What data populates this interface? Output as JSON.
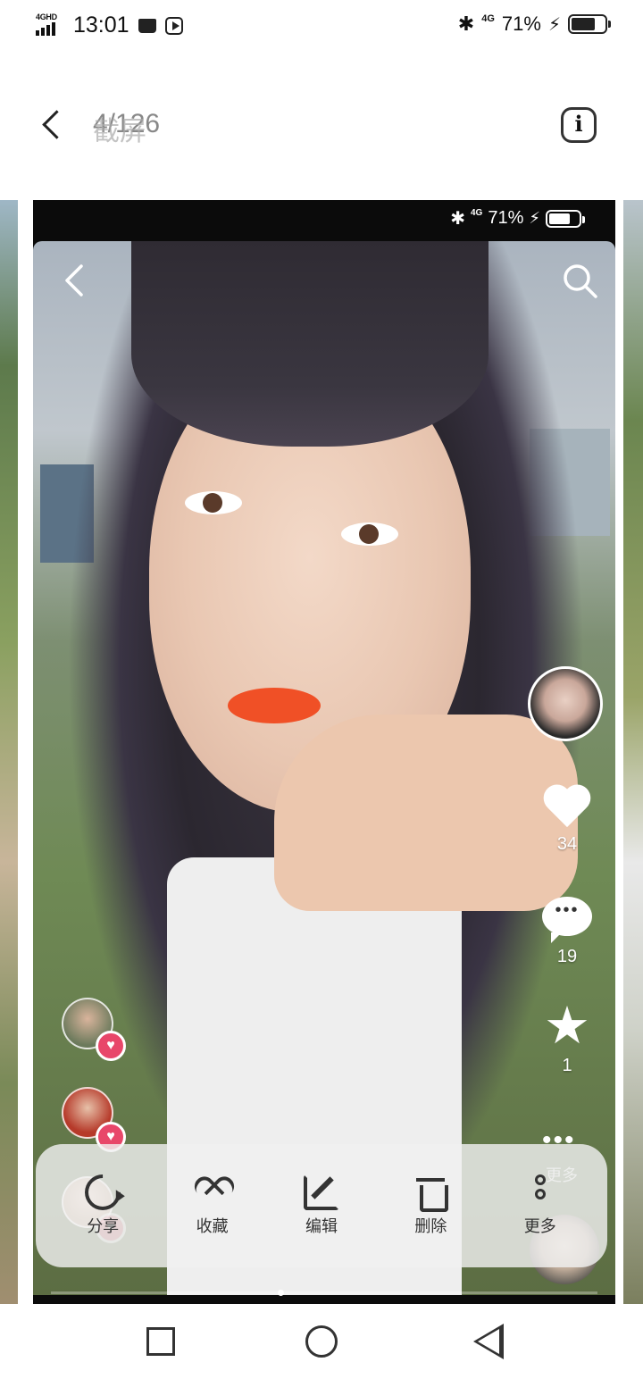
{
  "status_bar": {
    "network_label": "4GHD",
    "time": "13:01",
    "bluetooth_icon": "✱",
    "mobile_data": "4G",
    "battery_percent": "71%",
    "charging_icon": "⚡",
    "battery_level": 0.71
  },
  "top_nav": {
    "title_primary": "4/126",
    "title_overlay": "截屏"
  },
  "inner_status": {
    "mobile_data": "4G",
    "battery_percent": "71%",
    "battery_level": 0.71
  },
  "right_rail": {
    "like_count": "34",
    "comment_count": "19",
    "star_count": "1",
    "more_overlay_label": "更多"
  },
  "action_sheet": {
    "items": [
      {
        "label": "分享",
        "icon": "share-icon"
      },
      {
        "label": "收藏",
        "icon": "heart-outline-icon"
      },
      {
        "label": "编辑",
        "icon": "edit-icon"
      },
      {
        "label": "删除",
        "icon": "trash-icon"
      },
      {
        "label": "更多",
        "icon": "more-vertical-icon"
      }
    ]
  },
  "colors": {
    "accent_heart": "#e8476a",
    "lips": "#f05026",
    "sheet_bg": "#f0f0f0"
  }
}
